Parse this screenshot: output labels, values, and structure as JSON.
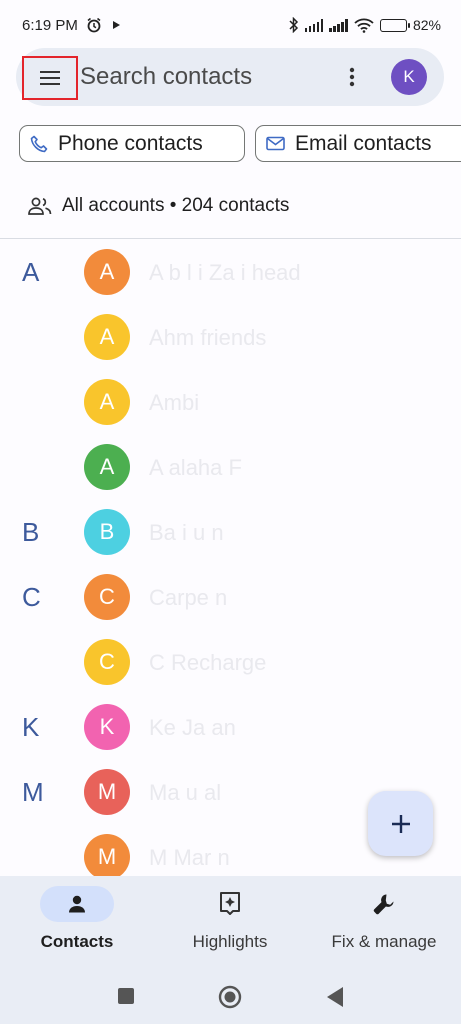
{
  "status_bar": {
    "time": "6:19 PM",
    "battery": "82%",
    "battery_level": 0.82
  },
  "search": {
    "placeholder": "Search contacts",
    "account_initial": "K",
    "account_color": "#6e4fc2"
  },
  "chips": {
    "phone": "Phone contacts",
    "email": "Email contacts"
  },
  "accounts_summary": "All accounts • 204 contacts",
  "contacts": [
    {
      "section": "A",
      "initial": "A",
      "color": "#f28b3b",
      "name": "A b   l    i Za i  head"
    },
    {
      "section": "",
      "initial": "A",
      "color": "#f9c52c",
      "name": "Ahm     friends"
    },
    {
      "section": "",
      "initial": "A",
      "color": "#f9c52c",
      "name": "Ambi"
    },
    {
      "section": "",
      "initial": "A",
      "color": "#4caf50",
      "name": "A   alaha F"
    },
    {
      "section": "B",
      "initial": "B",
      "color": "#4dd0e1",
      "name": "Ba  i  u   n"
    },
    {
      "section": "C",
      "initial": "C",
      "color": "#f28b3b",
      "name": "Carpe  n"
    },
    {
      "section": "",
      "initial": "C",
      "color": "#f9c52c",
      "name": "C   Recharge"
    },
    {
      "section": "K",
      "initial": "K",
      "color": "#f263b0",
      "name": "Ke   Ja   an"
    },
    {
      "section": "M",
      "initial": "M",
      "color": "#e8625a",
      "name": "Ma   u  al"
    },
    {
      "section": "",
      "initial": "M",
      "color": "#f28b3b",
      "name": "M   Mar  n"
    }
  ],
  "fab": {
    "label": "+"
  },
  "bottom_nav": [
    {
      "label": "Contacts",
      "icon": "person-icon",
      "active": true
    },
    {
      "label": "Highlights",
      "icon": "highlights-icon",
      "active": false
    },
    {
      "label": "Fix & manage",
      "icon": "wrench-icon",
      "active": false
    }
  ],
  "system_nav": [
    "recents-icon",
    "home-icon",
    "back-icon"
  ]
}
